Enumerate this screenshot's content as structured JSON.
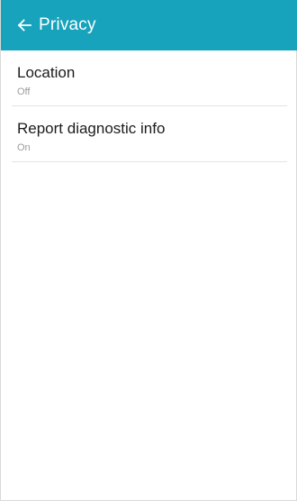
{
  "colors": {
    "app_bar": "#17a3bc",
    "summary_text": "#9c9c9c"
  },
  "header": {
    "back_icon": "arrow-left-icon",
    "title": "Privacy"
  },
  "items": [
    {
      "title": "Location",
      "summary": "Off"
    },
    {
      "title": "Report diagnostic info",
      "summary": "On"
    }
  ]
}
